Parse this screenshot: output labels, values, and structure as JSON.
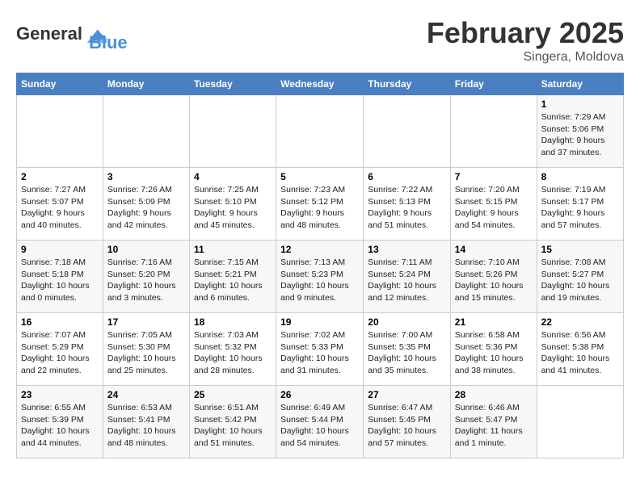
{
  "header": {
    "logo_line1": "General",
    "logo_line2": "Blue",
    "month_title": "February 2025",
    "location": "Singera, Moldova"
  },
  "days_of_week": [
    "Sunday",
    "Monday",
    "Tuesday",
    "Wednesday",
    "Thursday",
    "Friday",
    "Saturday"
  ],
  "weeks": [
    [
      {
        "day": "",
        "info": ""
      },
      {
        "day": "",
        "info": ""
      },
      {
        "day": "",
        "info": ""
      },
      {
        "day": "",
        "info": ""
      },
      {
        "day": "",
        "info": ""
      },
      {
        "day": "",
        "info": ""
      },
      {
        "day": "1",
        "info": "Sunrise: 7:29 AM\nSunset: 5:06 PM\nDaylight: 9 hours and 37 minutes."
      }
    ],
    [
      {
        "day": "2",
        "info": "Sunrise: 7:27 AM\nSunset: 5:07 PM\nDaylight: 9 hours and 40 minutes."
      },
      {
        "day": "3",
        "info": "Sunrise: 7:26 AM\nSunset: 5:09 PM\nDaylight: 9 hours and 42 minutes."
      },
      {
        "day": "4",
        "info": "Sunrise: 7:25 AM\nSunset: 5:10 PM\nDaylight: 9 hours and 45 minutes."
      },
      {
        "day": "5",
        "info": "Sunrise: 7:23 AM\nSunset: 5:12 PM\nDaylight: 9 hours and 48 minutes."
      },
      {
        "day": "6",
        "info": "Sunrise: 7:22 AM\nSunset: 5:13 PM\nDaylight: 9 hours and 51 minutes."
      },
      {
        "day": "7",
        "info": "Sunrise: 7:20 AM\nSunset: 5:15 PM\nDaylight: 9 hours and 54 minutes."
      },
      {
        "day": "8",
        "info": "Sunrise: 7:19 AM\nSunset: 5:17 PM\nDaylight: 9 hours and 57 minutes."
      }
    ],
    [
      {
        "day": "9",
        "info": "Sunrise: 7:18 AM\nSunset: 5:18 PM\nDaylight: 10 hours and 0 minutes."
      },
      {
        "day": "10",
        "info": "Sunrise: 7:16 AM\nSunset: 5:20 PM\nDaylight: 10 hours and 3 minutes."
      },
      {
        "day": "11",
        "info": "Sunrise: 7:15 AM\nSunset: 5:21 PM\nDaylight: 10 hours and 6 minutes."
      },
      {
        "day": "12",
        "info": "Sunrise: 7:13 AM\nSunset: 5:23 PM\nDaylight: 10 hours and 9 minutes."
      },
      {
        "day": "13",
        "info": "Sunrise: 7:11 AM\nSunset: 5:24 PM\nDaylight: 10 hours and 12 minutes."
      },
      {
        "day": "14",
        "info": "Sunrise: 7:10 AM\nSunset: 5:26 PM\nDaylight: 10 hours and 15 minutes."
      },
      {
        "day": "15",
        "info": "Sunrise: 7:08 AM\nSunset: 5:27 PM\nDaylight: 10 hours and 19 minutes."
      }
    ],
    [
      {
        "day": "16",
        "info": "Sunrise: 7:07 AM\nSunset: 5:29 PM\nDaylight: 10 hours and 22 minutes."
      },
      {
        "day": "17",
        "info": "Sunrise: 7:05 AM\nSunset: 5:30 PM\nDaylight: 10 hours and 25 minutes."
      },
      {
        "day": "18",
        "info": "Sunrise: 7:03 AM\nSunset: 5:32 PM\nDaylight: 10 hours and 28 minutes."
      },
      {
        "day": "19",
        "info": "Sunrise: 7:02 AM\nSunset: 5:33 PM\nDaylight: 10 hours and 31 minutes."
      },
      {
        "day": "20",
        "info": "Sunrise: 7:00 AM\nSunset: 5:35 PM\nDaylight: 10 hours and 35 minutes."
      },
      {
        "day": "21",
        "info": "Sunrise: 6:58 AM\nSunset: 5:36 PM\nDaylight: 10 hours and 38 minutes."
      },
      {
        "day": "22",
        "info": "Sunrise: 6:56 AM\nSunset: 5:38 PM\nDaylight: 10 hours and 41 minutes."
      }
    ],
    [
      {
        "day": "23",
        "info": "Sunrise: 6:55 AM\nSunset: 5:39 PM\nDaylight: 10 hours and 44 minutes."
      },
      {
        "day": "24",
        "info": "Sunrise: 6:53 AM\nSunset: 5:41 PM\nDaylight: 10 hours and 48 minutes."
      },
      {
        "day": "25",
        "info": "Sunrise: 6:51 AM\nSunset: 5:42 PM\nDaylight: 10 hours and 51 minutes."
      },
      {
        "day": "26",
        "info": "Sunrise: 6:49 AM\nSunset: 5:44 PM\nDaylight: 10 hours and 54 minutes."
      },
      {
        "day": "27",
        "info": "Sunrise: 6:47 AM\nSunset: 5:45 PM\nDaylight: 10 hours and 57 minutes."
      },
      {
        "day": "28",
        "info": "Sunrise: 6:46 AM\nSunset: 5:47 PM\nDaylight: 11 hours and 1 minute."
      },
      {
        "day": "",
        "info": ""
      }
    ]
  ]
}
